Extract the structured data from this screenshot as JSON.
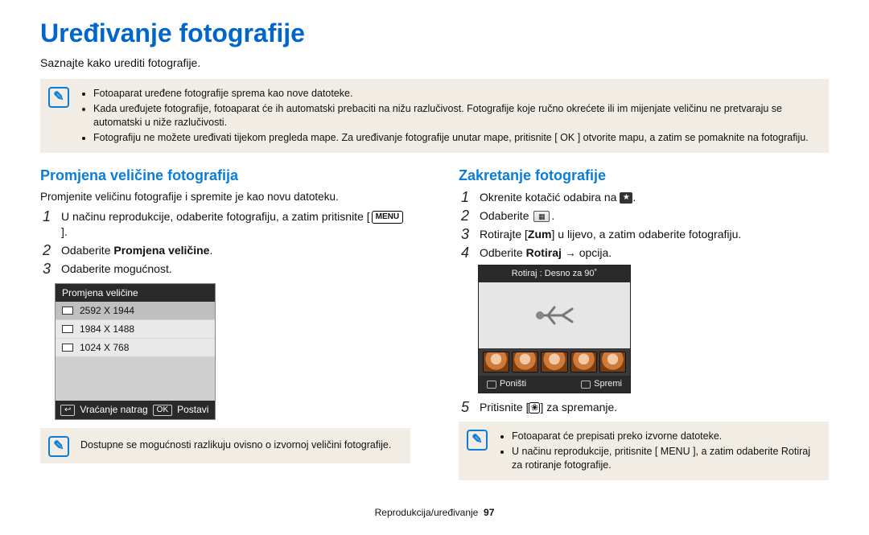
{
  "title": "Uređivanje fotografije",
  "subtitle": "Saznajte kako urediti fotografije.",
  "top_note": {
    "bullets": [
      "Fotoaparat uređene fotografije sprema kao nove datoteke.",
      "Kada uređujete fotografije, fotoaparat će ih automatski prebaciti na nižu razlučivost. Fotografije koje ručno okrećete ili im mijenjate veličinu ne pretvaraju se automatski u niže razlučivosti.",
      "Fotografiju ne možete uređivati tijekom pregleda mape. Za uređivanje fotografije unutar mape, pritisnite [ OK ] otvorite mapu, a zatim se pomaknite na fotografiju."
    ]
  },
  "left": {
    "heading": "Promjena veličine fotografija",
    "desc": "Promjenite veličinu fotografije i spremite je kao novu datoteku.",
    "steps": [
      {
        "n": "1",
        "pre": "U načinu reprodukcije, odaberite fotografiju, a zatim pritisnite [",
        "button": "MENU",
        "post": "]."
      },
      {
        "n": "2",
        "pre": "Odaberite ",
        "bold": "Promjena veličine",
        "post": "."
      },
      {
        "n": "3",
        "pre": "Odaberite mogućnost."
      }
    ],
    "ui": {
      "header": "Promjena veličine",
      "options": [
        "2592 X 1944",
        "1984 X 1488",
        "1024 X 768"
      ],
      "back_label": "Vraćanje natrag",
      "ok_label": "OK",
      "set_label": "Postavi"
    },
    "bottom_note": "Dostupne se mogućnosti razlikuju ovisno o izvornoj veličini fotografije."
  },
  "right": {
    "heading": "Zakretanje fotografije",
    "steps": [
      {
        "n": "1",
        "text": "Okrenite kotačić odabira na ",
        "icon": "star"
      },
      {
        "n": "2",
        "text": "Odaberite ",
        "icon": "thumb"
      },
      {
        "n": "3",
        "pre": "Rotirajte [",
        "bold": "Zum",
        "post": "] u lijevo, a zatim odaberite fotografiju."
      },
      {
        "n": "4",
        "pre": "Odberite ",
        "bold": "Rotiraj",
        "post": " → opcija."
      }
    ],
    "rotate_ui": {
      "header": "Rotiraj : Desno za 90˚",
      "cancel": "Poništi",
      "save": "Spremi"
    },
    "step5": {
      "n": "5",
      "pre": "Pritisnite [",
      "icon": "down",
      "post": "] za spremanje."
    },
    "bottom_note": {
      "bullets": [
        "Fotoaparat će prepisati preko izvorne datoteke.",
        "U načinu reprodukcije, pritisnite [ MENU ], a zatim odaberite Rotiraj za rotiranje fotografije."
      ]
    }
  },
  "footer": {
    "text": "Reprodukcija/uređivanje",
    "page": "97"
  }
}
